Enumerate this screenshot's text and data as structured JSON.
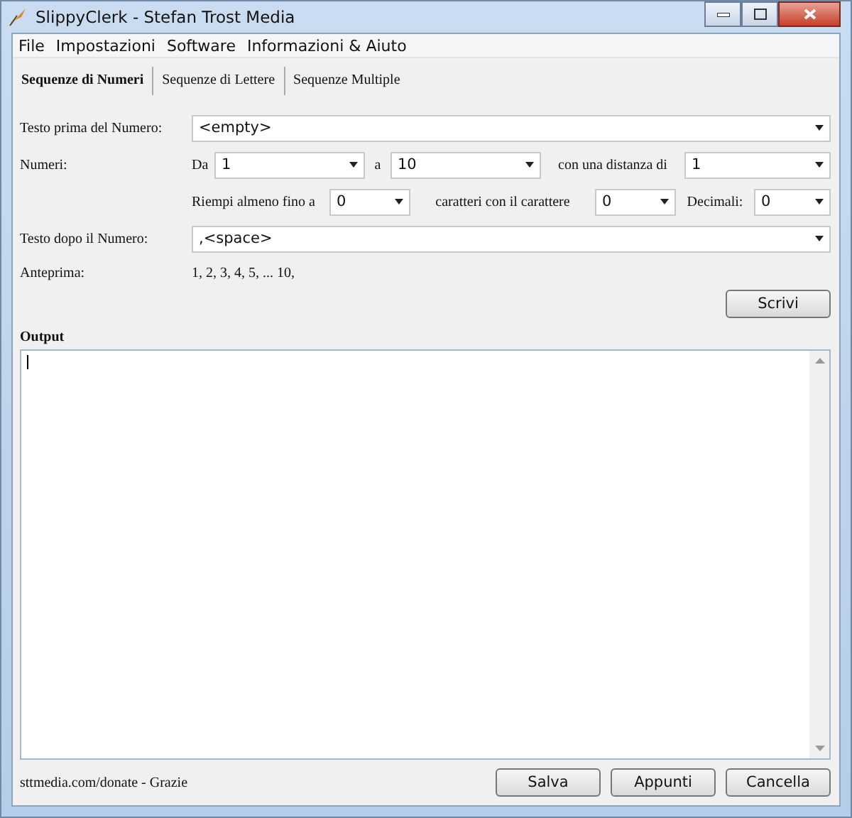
{
  "window": {
    "title": "SlippyClerk - Stefan Trost Media"
  },
  "menu": [
    "File",
    "Impostazioni",
    "Software",
    "Informazioni & Aiuto"
  ],
  "tabs": [
    {
      "label": "Sequenze di Numeri",
      "selected": true
    },
    {
      "label": "Sequenze di Lettere",
      "selected": false
    },
    {
      "label": "Sequenze Multiple",
      "selected": false
    }
  ],
  "text_before": {
    "label": "Testo prima del Numero:",
    "value": "<empty>"
  },
  "numbers": {
    "label": "Numeri:",
    "from_label": "Da",
    "from": "1",
    "to_label": "a",
    "to": "10",
    "step_label": "con una distanza di",
    "step": "1"
  },
  "padding": {
    "fill_label": "Riempi almeno fino a",
    "fill": "0",
    "char_label": "caratteri con il carattere",
    "char": "0",
    "decimals_label": "Decimali:",
    "decimals": "0"
  },
  "text_after": {
    "label": "Testo dopo il Numero:",
    "value": ",<space>"
  },
  "preview": {
    "label": "Anteprima:",
    "value": "1, 2, 3, 4, 5, ... 10,"
  },
  "write_button": "Scrivi",
  "output": {
    "label": "Output"
  },
  "footer": {
    "link": "sttmedia.com/donate - Grazie",
    "buttons": [
      "Salva",
      "Appunti",
      "Cancella"
    ]
  }
}
